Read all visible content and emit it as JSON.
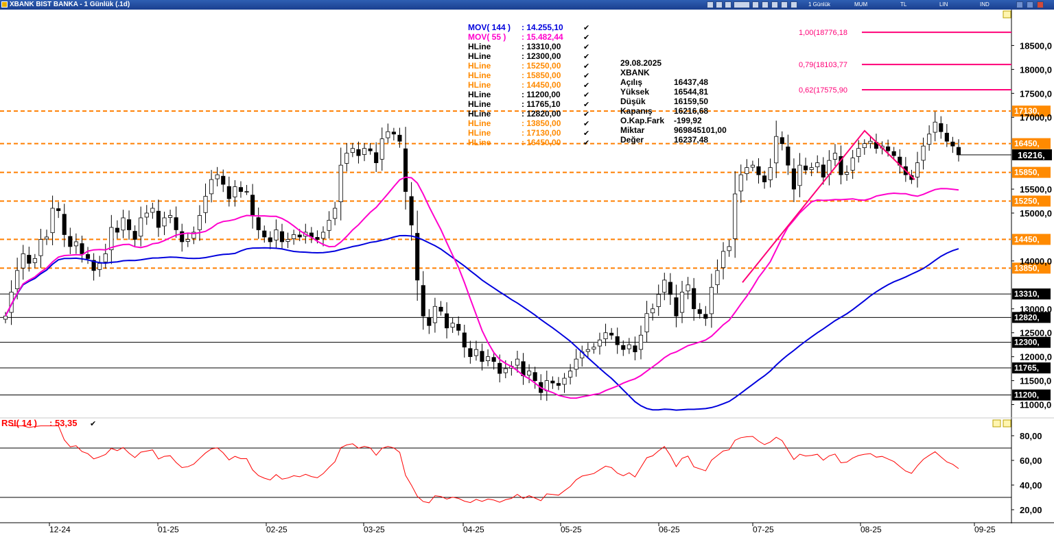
{
  "window": {
    "title": "XBANK BIST BANKA - 1 Günlük (.1d)",
    "toolbar": [
      "1 Günlük",
      "MUM",
      "TL",
      "LIN",
      "IND"
    ]
  },
  "colors": {
    "up": "#ffffff",
    "down": "#000000",
    "mov144": "#0000dd",
    "mov55": "#ff00cc",
    "hline_orange": "#ff7f00",
    "hline_black": "#000000",
    "rsi": "#ff0000",
    "fib": "#ff0077"
  },
  "chart_data": [
    {
      "type": "candlestick",
      "title": "XBANK BIST BANKA - 1 Günlük (.1d)",
      "x_ticks": [
        "12-24",
        "01-25",
        "02-25",
        "03-25",
        "04-25",
        "05-25",
        "06-25",
        "07-25",
        "08-25",
        "09-25"
      ],
      "y_ticks": [
        "18500,0",
        "18000,0",
        "17500,0",
        "17000,0",
        "15500,0",
        "15000,0",
        "14000,0",
        "13000,0",
        "12500,0",
        "12000,0",
        "11500,0",
        "11000,0"
      ],
      "ylim": [
        10750,
        19250
      ],
      "series": [
        {
          "name": "MOV( 144 )",
          "value": "14.255,10",
          "color": "#0000dd"
        },
        {
          "name": "MOV( 55 )",
          "value": "15.482,44",
          "color": "#ff00cc"
        }
      ],
      "closes": [
        12850,
        13350,
        13800,
        14150,
        13950,
        14050,
        14450,
        14500,
        15100,
        15050,
        14550,
        14300,
        14400,
        14150,
        14050,
        13800,
        13950,
        14150,
        14700,
        14600,
        14900,
        14650,
        14450,
        14900,
        15000,
        15100,
        14700,
        14900,
        14950,
        14650,
        14400,
        14450,
        14600,
        14950,
        15350,
        15700,
        15800,
        15600,
        15300,
        15550,
        15450,
        15450,
        14950,
        14650,
        14500,
        14400,
        14650,
        14400,
        14450,
        14550,
        14500,
        14600,
        14500,
        14450,
        14600,
        14850,
        15100,
        16000,
        16250,
        16350,
        16200,
        16350,
        16300,
        16050,
        16550,
        16700,
        16650,
        16500,
        15450,
        14750,
        13600,
        12850,
        12650,
        13050,
        12950,
        12600,
        12700,
        12550,
        12200,
        12000,
        12150,
        11900,
        12000,
        11900,
        11650,
        11750,
        11800,
        11950,
        11600,
        11700,
        11500,
        11250,
        11500,
        11450,
        11400,
        11550,
        11700,
        11950,
        12100,
        12150,
        12200,
        12350,
        12500,
        12450,
        12250,
        12150,
        12250,
        12100,
        12450,
        12900,
        13000,
        13300,
        13600,
        13300,
        12850,
        13350,
        13500,
        13000,
        12900,
        12800,
        13450,
        13800,
        14200,
        14300,
        15400,
        15800,
        15950,
        16000,
        15800,
        15650,
        15950,
        16600,
        16450,
        16000,
        15500,
        16000,
        15900,
        15950,
        16050,
        15750,
        16100,
        16250,
        15800,
        15850,
        16150,
        16350,
        16450,
        16500,
        16350,
        16400,
        16300,
        16200,
        16000,
        15800,
        15700,
        16050,
        16400,
        16650,
        16900,
        16700,
        16500,
        16400,
        16216.68
      ],
      "mov144_endpoints": [
        13900,
        14255.1
      ],
      "mov55_endpoints": [
        12850,
        15482.44
      ],
      "hlines": [
        {
          "label": "HLine",
          "value": "13310,00",
          "color": "#000000",
          "tag": "13310,"
        },
        {
          "label": "HLine",
          "value": "12300,00",
          "color": "#000000",
          "tag": "12300,"
        },
        {
          "label": "HLine",
          "value": "15250,00",
          "color": "#ff7f00",
          "tag": "15250,"
        },
        {
          "label": "HLine",
          "value": "15850,00",
          "color": "#ff7f00",
          "tag": "15850,"
        },
        {
          "label": "HLine",
          "value": "14450,00",
          "color": "#ff7f00",
          "tag": "14450,"
        },
        {
          "label": "HLine",
          "value": "11200,00",
          "color": "#000000",
          "tag": "11200,"
        },
        {
          "label": "HLine",
          "value": "11765,10",
          "color": "#000000",
          "tag": "11765,"
        },
        {
          "label": "HLine",
          "value": "12820,00",
          "color": "#000000",
          "tag": "12820,"
        },
        {
          "label": "HLine",
          "value": "13850,00",
          "color": "#ff7f00",
          "tag": "13850,"
        },
        {
          "label": "HLine",
          "value": "17130,00",
          "color": "#ff7f00",
          "tag": "17130,"
        },
        {
          "label": "HLine",
          "value": "16450,00",
          "color": "#ff7f00",
          "tag": "16450,"
        }
      ],
      "fibonacci": [
        {
          "label": "1,00(18776,18",
          "value": 18776.18
        },
        {
          "label": "0,79(18103,77",
          "value": 18103.77
        },
        {
          "label": "0,62(17575,90",
          "value": 17575.9
        }
      ],
      "last_price_tag": "16216,",
      "info_box": {
        "date": "29.08.2025",
        "symbol": "XBANK",
        "rows": [
          [
            "Açılış",
            "16437,48"
          ],
          [
            "Yüksek",
            "16544,81"
          ],
          [
            "Düşük",
            "16159,50"
          ],
          [
            "Kapanış",
            "16216,68"
          ],
          [
            "O.Kap.Fark",
            "-199,92"
          ],
          [
            "Miktar",
            "969845101,00"
          ],
          [
            "Değer",
            "16237,48"
          ]
        ]
      }
    },
    {
      "type": "line",
      "title": "RSI( 14 )",
      "series": [
        {
          "name": "RSI( 14 )",
          "value": "53,35",
          "color": "#ff0000"
        }
      ],
      "y_ticks": [
        "80,00",
        "60,00",
        "40,00",
        "20,00"
      ],
      "ylim": [
        10,
        90
      ],
      "levels": [
        70,
        30
      ]
    }
  ]
}
